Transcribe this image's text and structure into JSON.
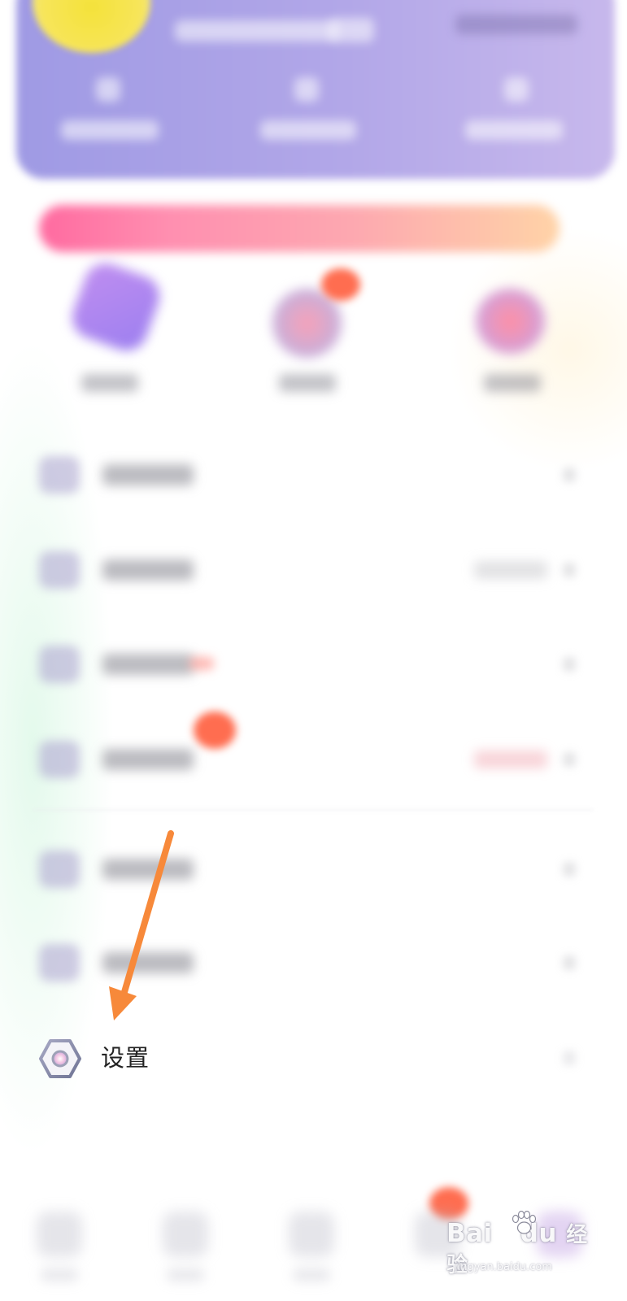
{
  "settings": {
    "label": "设置",
    "icon": "hexagon-gear-icon"
  },
  "annotation": {
    "arrow_color": "#f7893a",
    "target": "settings-row"
  },
  "watermark": {
    "brand": "Bai",
    "brand_suffix": "du",
    "product": "经验",
    "url": "jingyan.baidu.com"
  },
  "colors": {
    "header_start": "#9f9ae4",
    "header_end": "#c7b8ec",
    "promo_start": "#ff6aa0",
    "promo_end": "#ffd3a7",
    "arrow": "#f7893a",
    "badge": "#ff6d50",
    "text": "#232323"
  }
}
